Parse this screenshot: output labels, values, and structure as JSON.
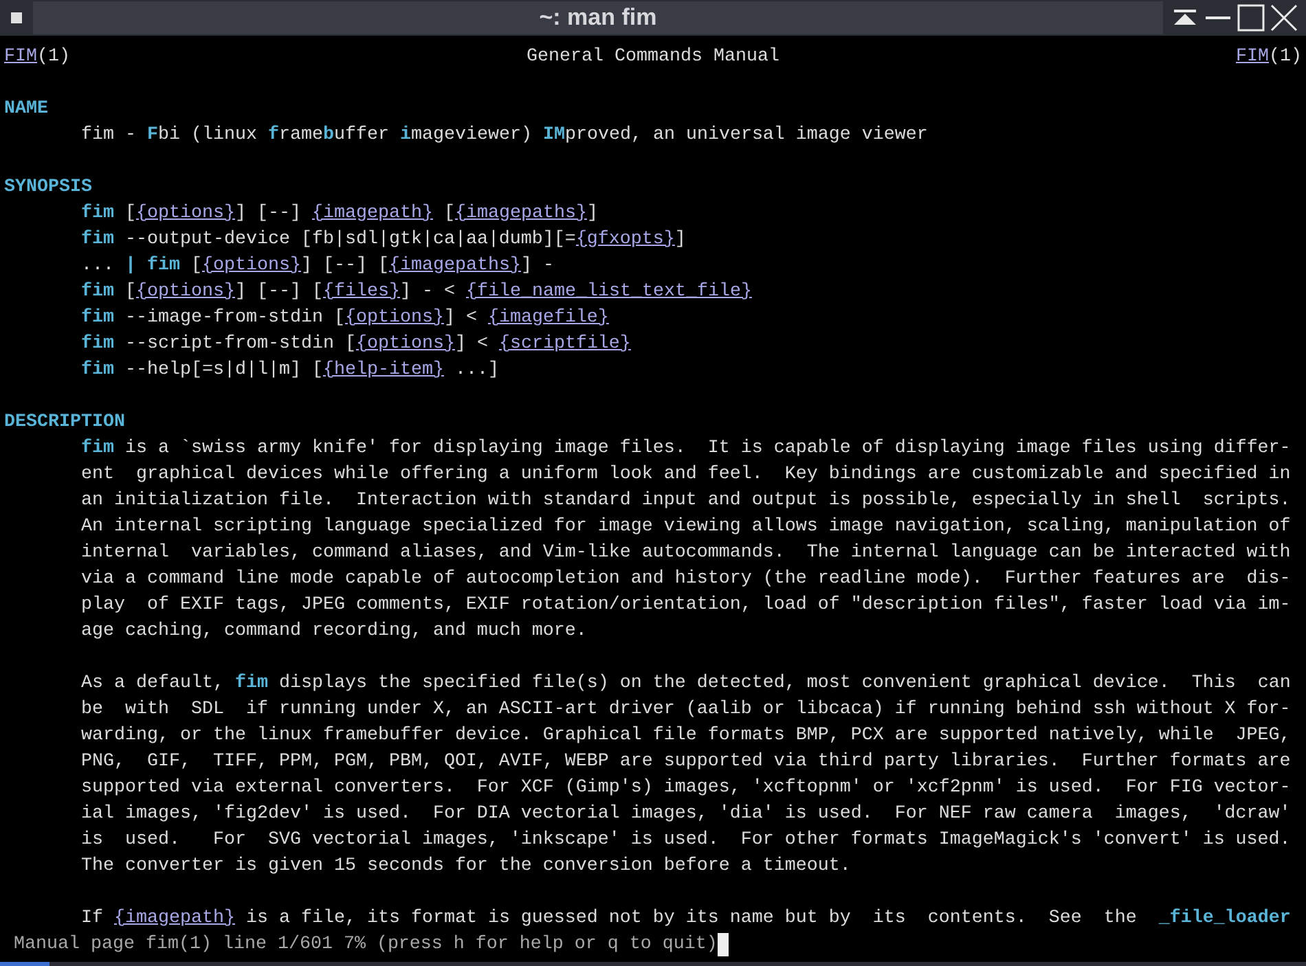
{
  "window": {
    "title": "~: man fim"
  },
  "header": {
    "left": "*FIM*(1)",
    "center": "General Commands Manual",
    "right": "*FIM*(1)"
  },
  "sections": [
    {
      "heading": "NAME",
      "paragraphs": [
        [
          "fim - **F**bi (linux **f**rame**b**uffer **i**mageviewer) **IM**proved, an universal image viewer"
        ]
      ]
    },
    {
      "heading": "SYNOPSIS",
      "paragraphs": [
        [
          "**fim** [*{options}*] [--] *{imagepath}* [*{imagepaths}*]",
          "**fim** --output-device [fb|sdl|gtk|ca|aa|dumb][=*{gfxopts}*]",
          "... **| fim** [*{options}*] [--] [*{imagepaths}*] -",
          "**fim** [*{options}*] [--] [*{files}*] - < *{file_name_list_text_file}*",
          "**fim** --image-from-stdin [*{options}*] < *{imagefile}*",
          "**fim** --script-from-stdin [*{options}*] < *{scriptfile}*",
          "**fim** --help[=s|d|l|m] [*{help-item}* ...]"
        ]
      ]
    },
    {
      "heading": "DESCRIPTION",
      "paragraphs": [
        [
          "**fim** is a `swiss army knife' for displaying image files.  It is capable of displaying image files using differ-",
          "ent  graphical devices while offering a uniform look and feel.  Key bindings are customizable and specified in",
          "an initialization file.  Interaction with standard input and output is possible, especially in shell  scripts.",
          "An internal scripting language specialized for image viewing allows image navigation, scaling, manipulation of",
          "internal  variables, command aliases, and Vim-like autocommands.  The internal language can be interacted with",
          "via a command line mode capable of autocompletion and history (the readline mode).  Further features are  dis-",
          "play  of EXIF tags, JPEG comments, EXIF rotation/orientation, load of \"description files\", faster load via im-",
          "age caching, command recording, and much more."
        ],
        [
          "As a default, **fim** displays the specified file(s) on the detected, most convenient graphical device.  This  can",
          "be  with  SDL  if running under X, an ASCII-art driver (aalib or libcaca) if running behind ssh without X for-",
          "warding, or the linux framebuffer device. Graphical file formats BMP, PCX are supported natively, while  JPEG,",
          "PNG,  GIF,  TIFF, PPM, PGM, PBM, QOI, AVIF, WEBP are supported via third party libraries.  Further formats are",
          "supported via external converters.  For XCF (Gimp's) images, 'xcftopnm' or 'xcf2pnm' is used.  For FIG vector-",
          "ial images, 'fig2dev' is used.  For DIA vectorial images, 'dia' is used.  For NEF raw camera  images,  'dcraw'",
          "is  used.   For  SVG vectorial images, 'inkscape' is used.  For other formats ImageMagick's 'convert' is used.",
          "The converter is given 15 seconds for the conversion before a timeout."
        ],
        [
          "If *{imagepath}* is a file, its format is guessed not by its name but by  its  contents.  See  the  **_file_loader**"
        ]
      ]
    }
  ],
  "status_line": "Manual page fim(1) line 1/601 7% (press h for help or q to quit)"
}
